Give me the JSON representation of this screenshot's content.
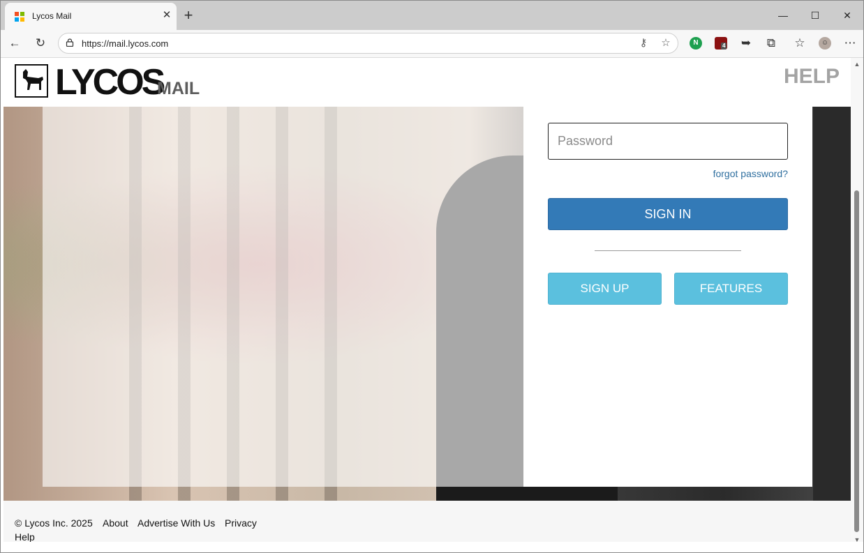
{
  "browser": {
    "tab_title": "Lycos Mail",
    "tab_close": "✕",
    "new_tab": "+",
    "url": "https://mail.lycos.com",
    "window_controls": {
      "minimize": "—",
      "maximize": "☐",
      "close": "✕"
    },
    "extension_badge": "4"
  },
  "header": {
    "logo_text": "LYCOS",
    "logo_sub": "MAIL",
    "help_link": "HELP"
  },
  "login": {
    "password_placeholder": "Password",
    "password_value": "",
    "forgot_link": "forgot password?",
    "signin_label": "SIGN IN",
    "signup_label": "SIGN UP",
    "features_label": "FEATURES"
  },
  "footer": {
    "copyright": "© Lycos Inc. 2025",
    "links": [
      "About",
      "Advertise With Us",
      "Privacy",
      "Help"
    ]
  },
  "colors": {
    "signin_blue": "#337ab7",
    "secondary_blue": "#5bc0de",
    "link_blue": "#2f6f9f",
    "help_gray": "#a3a3a3"
  }
}
